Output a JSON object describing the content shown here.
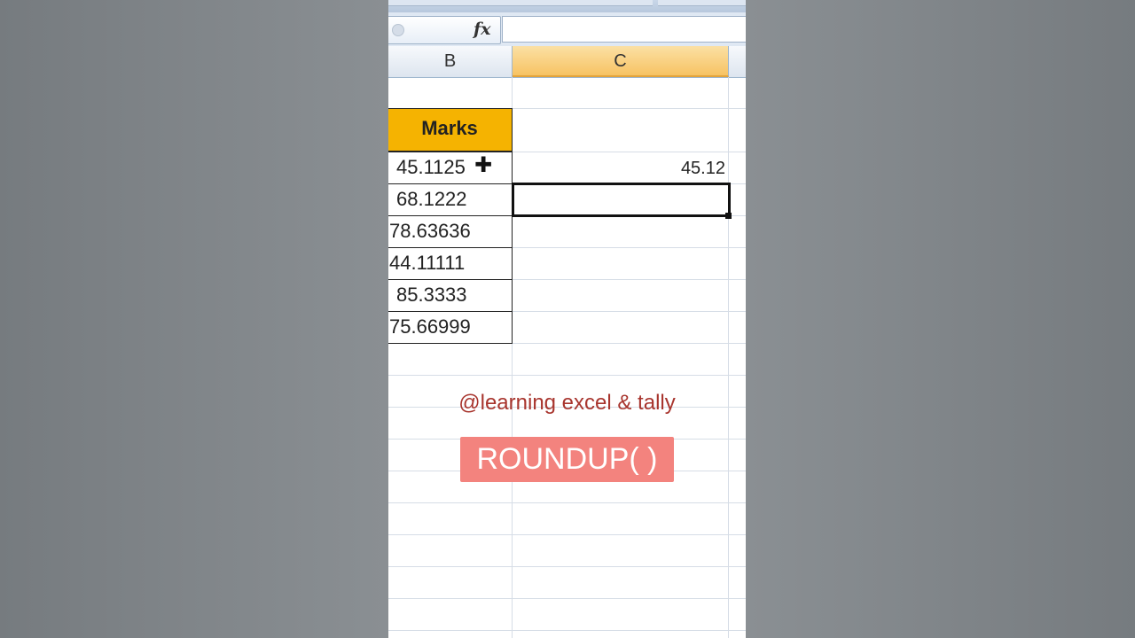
{
  "formula_bar": {
    "fx_label": "fx",
    "formula_value": ""
  },
  "columns": [
    {
      "label": "B",
      "selected": false
    },
    {
      "label": "C",
      "selected": true
    }
  ],
  "table": {
    "header": "Marks",
    "values": [
      "45.1125",
      "68.1222",
      "78.63636",
      "44.11111",
      "85.3333",
      "75.66999"
    ]
  },
  "column_c": {
    "row1_result": "45.12"
  },
  "overlay": {
    "watermark": "@learning excel & tally",
    "function_label": "ROUNDUP( )"
  },
  "colors": {
    "header_fill": "#f5b301",
    "selected_column_header": "#f7c363",
    "badge_fill": "#f3837e",
    "watermark_text": "#a8352e"
  },
  "icons": {
    "cursor": "cross-cursor-icon",
    "fx": "function-icon"
  }
}
